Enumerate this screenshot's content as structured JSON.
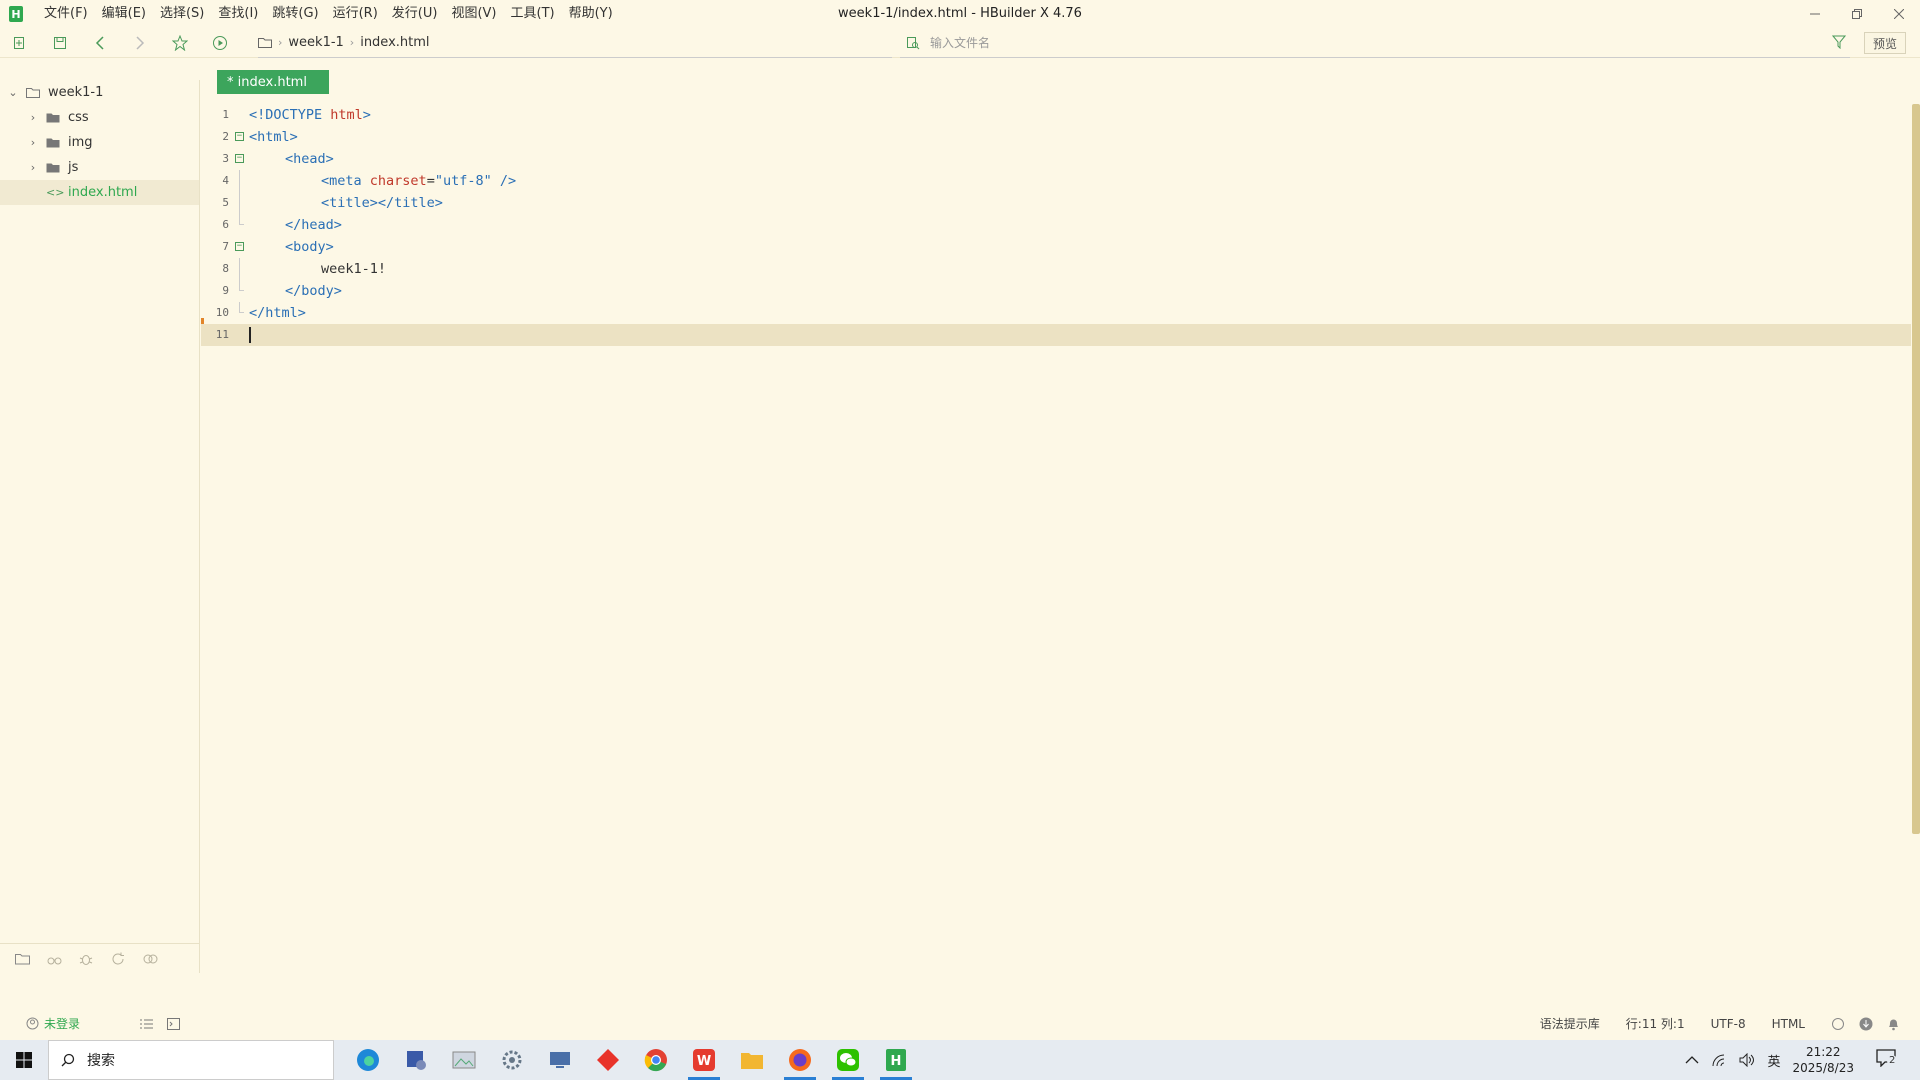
{
  "window": {
    "title": "week1-1/index.html - HBuilder X 4.76",
    "logo": "H"
  },
  "menu": [
    "文件(F)",
    "编辑(E)",
    "选择(S)",
    "查找(I)",
    "跳转(G)",
    "运行(R)",
    "发行(U)",
    "视图(V)",
    "工具(T)",
    "帮助(Y)"
  ],
  "breadcrumb": [
    "week1-1",
    "index.html"
  ],
  "file_search": {
    "placeholder": "输入文件名",
    "value": ""
  },
  "toolbar": {
    "preview_label": "预览"
  },
  "sidebar": {
    "items": [
      {
        "label": "week1-1",
        "type": "folder",
        "expanded": true
      },
      {
        "label": "css",
        "type": "folder",
        "expanded": false
      },
      {
        "label": "img",
        "type": "folder",
        "expanded": false
      },
      {
        "label": "js",
        "type": "folder",
        "expanded": false
      },
      {
        "label": "index.html",
        "type": "file",
        "active": true
      }
    ]
  },
  "editor": {
    "tab_label": "* index.html",
    "line_numbers": [
      "1",
      "2",
      "3",
      "4",
      "5",
      "6",
      "7",
      "8",
      "9",
      "10",
      "11"
    ],
    "lines": [
      [
        "<!DOCTYPE ",
        "html",
        ">"
      ],
      [
        "<html>"
      ],
      [
        "<head>"
      ],
      [
        "<meta ",
        "charset",
        "=",
        "\"utf-8\"",
        " />"
      ],
      [
        "<title></title>"
      ],
      [
        "</head>"
      ],
      [
        "<body>"
      ],
      [
        "week1-1!"
      ],
      [
        "</body>"
      ],
      [
        "</html>"
      ],
      [
        ""
      ]
    ]
  },
  "status": {
    "login": "未登录",
    "syntax_lib": "语法提示库",
    "position": "行:11  列:1",
    "encoding": "UTF-8",
    "language": "HTML"
  },
  "taskbar": {
    "search_label": "搜索",
    "ime": "英",
    "time": "21:22",
    "date": "2025/8/23",
    "notification_count": "2"
  },
  "colors": {
    "background": "#fdf8e6",
    "accent": "#2fa84f",
    "tag": "#2a6fb5",
    "attribute": "#c0392b",
    "current_line": "#ece2c3"
  }
}
